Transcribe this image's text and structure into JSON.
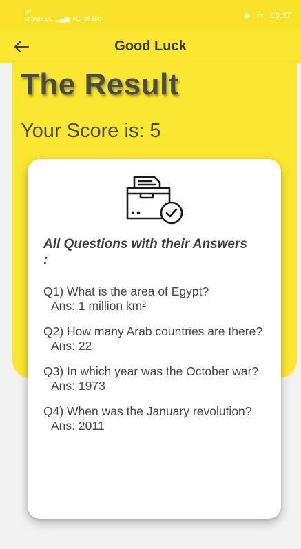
{
  "status_bar": {
    "carrier_line1": "Vo",
    "carrier_line2": "Orange EG",
    "network": "4G",
    "speed": "28 B/s",
    "time": "10:27"
  },
  "app_bar": {
    "title": "Good Luck",
    "back_icon": "arrow-left-icon"
  },
  "result": {
    "heading": "The Result",
    "score_text": "Your Score is: 5"
  },
  "card": {
    "icon": "document-check-icon",
    "section_title": "All Questions with their Answers :",
    "items": [
      {
        "question": "Q1) What is the area of Egypt?",
        "answer": "Ans: 1 million km²"
      },
      {
        "question": " Q2) How many Arab countries are there?",
        "answer": "Ans: 22"
      },
      {
        "question": " Q3) In which year was the October war?",
        "answer": "Ans: 1973"
      },
      {
        "question": " Q4) When was the January revolution?",
        "answer": "Ans: 2011"
      }
    ]
  },
  "colors": {
    "accent_yellow": "#fbe72f",
    "text_dark": "#4a4a4a",
    "background": "#f2f2f2"
  }
}
